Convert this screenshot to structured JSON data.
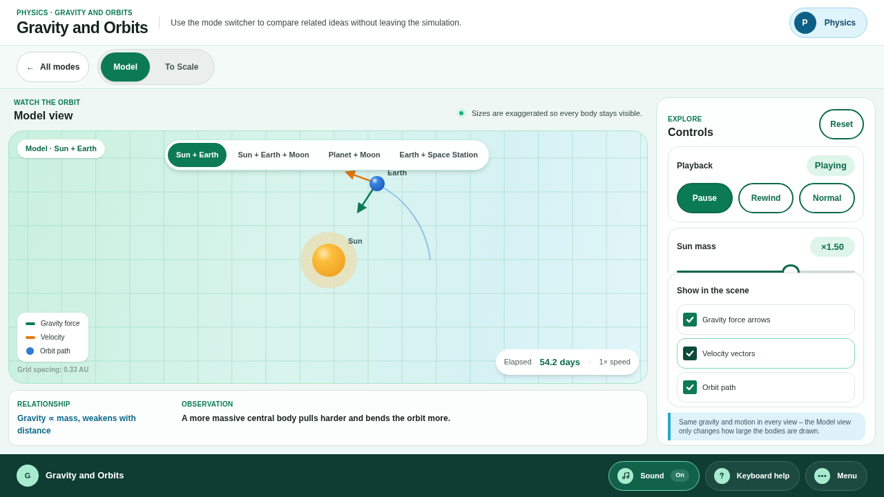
{
  "header": {
    "eyebrow": "PHYSICS · GRAVITY AND ORBITS",
    "title": "Gravity and Orbits",
    "subtitle": "Use the mode switcher to compare related ideas without leaving the simulation.",
    "subject": {
      "initial": "P",
      "label": "Physics"
    }
  },
  "mode_bar": {
    "back": {
      "arrow": "←",
      "label": "All modes"
    },
    "modes": [
      {
        "label": "Model",
        "selected": true
      },
      {
        "label": "To Scale",
        "selected": false
      }
    ]
  },
  "view": {
    "eyebrow": "WATCH THE ORBIT",
    "title": "Model view",
    "note": "Sizes are exaggerated so every body stays visible.",
    "scene": {
      "tag": "Model · Sun + Earth",
      "scenarios": [
        {
          "label": "Sun + Earth",
          "selected": true
        },
        {
          "label": "Sun + Earth + Moon",
          "selected": false
        },
        {
          "label": "Planet + Moon",
          "selected": false
        },
        {
          "label": "Earth + Space Station",
          "selected": false
        }
      ],
      "bodies": [
        {
          "name": "Earth",
          "kind": "planet"
        },
        {
          "name": "Sun",
          "kind": "star"
        }
      ],
      "legend": [
        {
          "label": "Gravity force",
          "kind": "line",
          "color": "#0b7a55"
        },
        {
          "label": "Velocity",
          "kind": "line",
          "color": "#e07a10"
        },
        {
          "label": "Orbit path",
          "kind": "dot",
          "color": "#2f7bd6"
        }
      ],
      "grid_note": "Grid spacing: 0.33 AU",
      "elapsed": {
        "label": "Elapsed",
        "value": "54.2 days",
        "separator": "·",
        "speed": "1× speed"
      }
    }
  },
  "summary": [
    {
      "heading": "RELATIONSHIP",
      "text": "Gravity ∝ mass, weakens with distance",
      "kind": "accent"
    },
    {
      "heading": "OBSERVATION",
      "text": "A more massive central body pulls harder and bends the orbit more.",
      "kind": "plain"
    }
  ],
  "controls": {
    "eyebrow": "EXPLORE",
    "title": "Controls",
    "reset": "Reset",
    "playback": {
      "label": "Playback",
      "status": "Playing",
      "buttons": [
        {
          "label": "Pause",
          "selected": true
        },
        {
          "label": "Rewind",
          "selected": false
        },
        {
          "label": "Normal",
          "selected": false
        }
      ]
    },
    "sun_mass": {
      "label": "Sun mass",
      "reading": "×1.50",
      "level": 0.64
    },
    "show": {
      "title": "Show in the scene",
      "options": [
        {
          "label": "Gravity force arrows",
          "checked": true,
          "highlighted": false
        },
        {
          "label": "Velocity vectors",
          "checked": true,
          "highlighted": true
        },
        {
          "label": "Orbit path",
          "checked": true,
          "highlighted": false
        }
      ]
    },
    "hint": "Same gravity and motion in every view – the Model view only changes how large the bodies are drawn."
  },
  "footer": {
    "app": {
      "initial": "G",
      "title": "Gravity and Orbits"
    },
    "buttons": [
      {
        "kind": "sound",
        "label": "Sound",
        "badge": "On",
        "selected": true
      },
      {
        "kind": "help",
        "label": "Keyboard help",
        "selected": false
      },
      {
        "kind": "menu",
        "label": "Menu",
        "selected": false
      }
    ]
  }
}
